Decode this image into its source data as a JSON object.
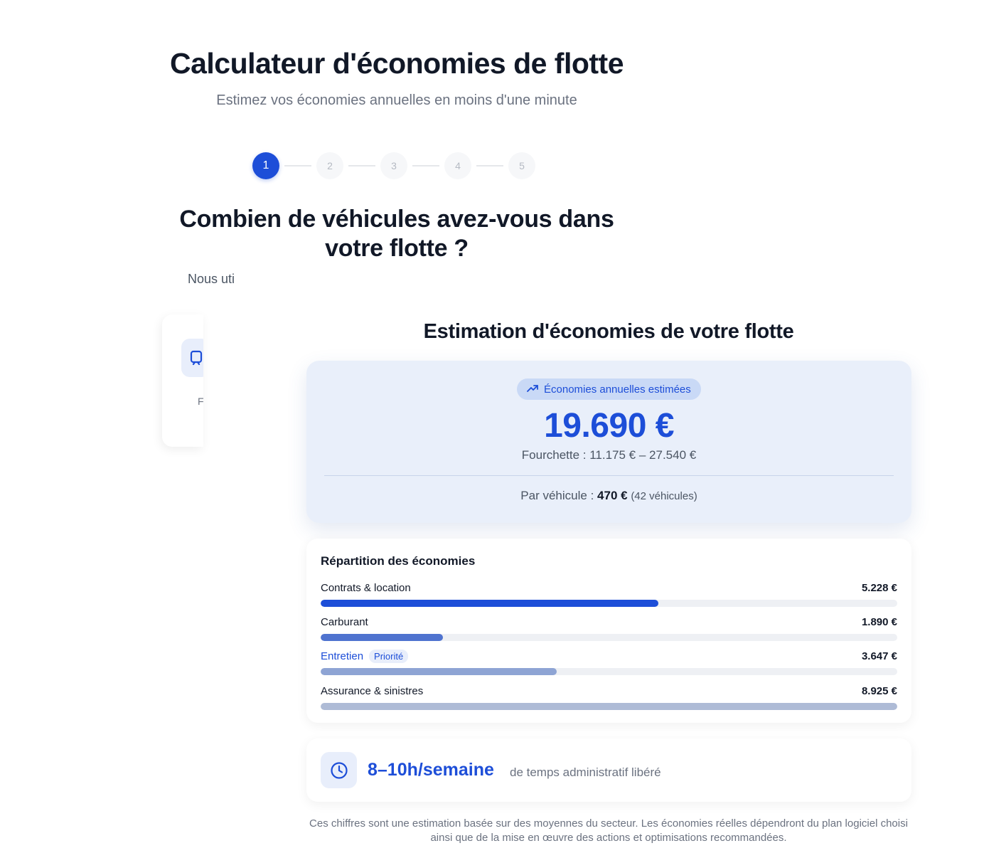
{
  "header": {
    "title": "Calculateur d'économies de flotte",
    "subtitle": "Estimez vos économies annuelles en moins d'une minute"
  },
  "stepper": {
    "steps": [
      "1",
      "2",
      "3",
      "4",
      "5"
    ],
    "active_step": 1
  },
  "question": {
    "title": "Combien de véhicules avez-vous dans votre flotte ?",
    "helper_fragment": "Nous uti"
  },
  "background_card": {
    "icon": "vehicle-icon",
    "text_fragment": "F"
  },
  "estimation": {
    "title": "Estimation d'économies de votre flotte",
    "badge_icon": "trending-up-icon",
    "badge_label": "Économies annuelles estimées",
    "amount": "19.690 €",
    "range": "Fourchette : 11.175 € – 27.540 €",
    "per_vehicle_label": "Par véhicule :",
    "per_vehicle_value": "470 €",
    "vehicle_count": "(42 véhicules)"
  },
  "breakdown": {
    "title": "Répartition des économies",
    "items": [
      {
        "label": "Contrats & location",
        "value": "5.228 €",
        "fraction": 0.586,
        "color": "#1d4ed8",
        "badge": ""
      },
      {
        "label": "Carburant",
        "value": "1.890 €",
        "fraction": 0.212,
        "color": "#4f73cf",
        "badge": ""
      },
      {
        "label": "Entretien",
        "value": "3.647 €",
        "fraction": 0.409,
        "color": "#8ea4d4",
        "badge": "Priorité"
      },
      {
        "label": "Assurance & sinistres",
        "value": "8.925 €",
        "fraction": 1.0,
        "color": "#aebbd6",
        "badge": ""
      }
    ]
  },
  "time_saved": {
    "icon": "clock-icon",
    "value": "8–10h/semaine",
    "description": "de temps administratif libéré"
  },
  "disclaimer": "Ces chiffres sont une estimation basée sur des moyennes du secteur. Les économies réelles dépendront du plan logiciel choisi ainsi que de la mise en œuvre des actions et optimisations recommandées."
}
